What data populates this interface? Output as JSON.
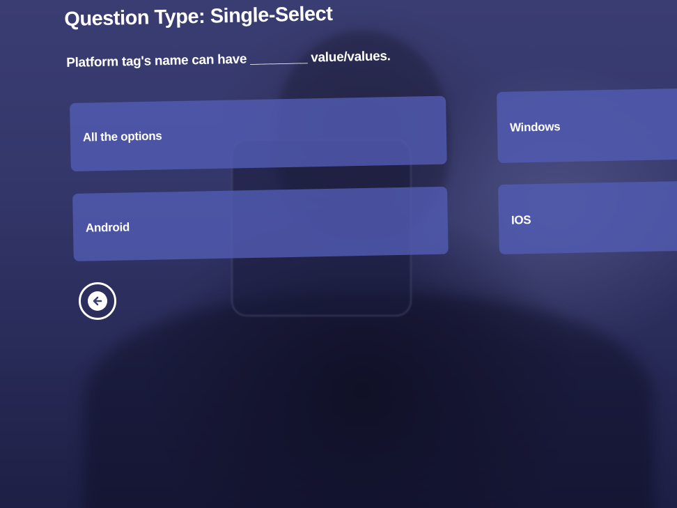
{
  "question": {
    "type_label": "Question Type: Single-Select",
    "text": "Platform tag's name can have ________ value/values."
  },
  "options": [
    {
      "label": "All the options"
    },
    {
      "label": "Windows"
    },
    {
      "label": "Android"
    },
    {
      "label": "IOS"
    }
  ],
  "navigation": {
    "back_icon": "arrow-left-icon"
  },
  "colors": {
    "background": "#34376a",
    "option_fill": "#525cb2",
    "text": "#ffffff"
  }
}
